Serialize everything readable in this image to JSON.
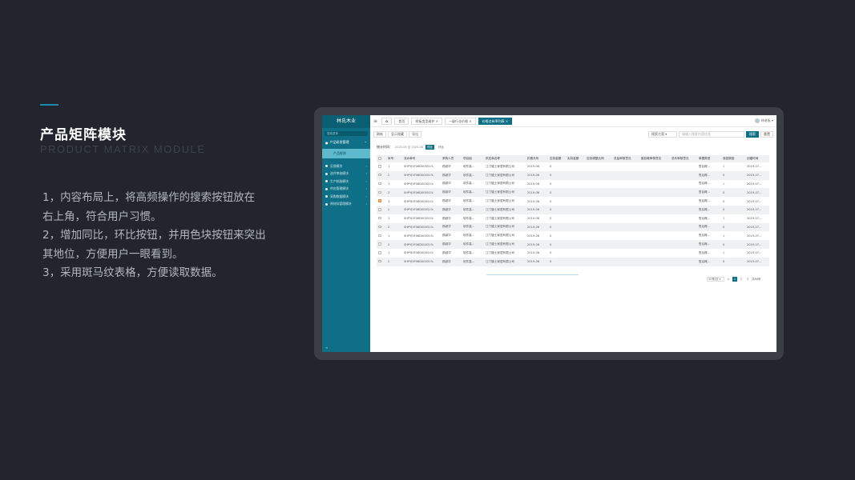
{
  "slide": {
    "title": "产品矩阵模块",
    "subtitle": "PRODUCT MATRIX MODULE",
    "points": [
      "1，内容布局上，将高频操作的搜索按钮放在",
      "右上角，符合用户习惯。",
      "2，增加同比，环比按钮，并用色块按钮来突出",
      "其地位，方便用户一眼看到。",
      "3，采用斑马纹表格，方便读取数据。"
    ]
  },
  "app": {
    "logo": "林氏木业",
    "sidebar": {
      "search": "搜索菜单",
      "group": "产品研发管理",
      "active": "产品矩阵",
      "items": [
        "反馈模块",
        "选件审核模块",
        "生产制造模块",
        "供应管理模块",
        "采购数据模块",
        "原材料管理模块"
      ],
      "collapse": "≡"
    },
    "topbar": {
      "menu": "≡",
      "settings": "✿",
      "tabs": [
        {
          "label": "首页",
          "active": false
        },
        {
          "label": "样板类型维护 ×",
          "active": false
        },
        {
          "label": "一级行业价格 ×",
          "active": false
        },
        {
          "label": "价格点有率列表 ×",
          "active": true
        }
      ],
      "user": "林老板 ▾"
    },
    "toolbar": {
      "buttons": [
        "刷新",
        "显示隐藏",
        "导出"
      ],
      "scheme": "搜索方案  ▾",
      "search_placeholder": "请输入搜索内容信息",
      "search": "搜索",
      "reset": "重置"
    },
    "stat": {
      "label": "统计时间：",
      "range": "2020-06 至 2020-06",
      "yoy": "同比",
      "mom": "环比"
    },
    "table": {
      "headers": [
        "",
        "序号",
        "流水单号",
        "采购人员",
        "项目组",
        "供应商名称",
        "扣费月份",
        "应扣金额",
        "实扣金额",
        "应扣调整比例",
        "总监审核意见",
        "副总裁审核意见",
        "总价审核意见",
        "单据类型",
        "驳回原因",
        "创建时间"
      ],
      "rows": [
        [
          "",
          "1",
          "SHPYJ5F06D00051%",
          "颜颖华",
          "软件高...",
          "江门骏士家居有限公司",
          "2019-06",
          "0",
          "",
          "",
          "",
          "",
          "",
          "售后概...",
          "1",
          "2019-07..."
        ],
        [
          "",
          "2",
          "SHPYJ5F06D00051%",
          "颜颖华",
          "软件高...",
          "江门骏士家居有限公司",
          "2019-06",
          "0",
          "",
          "",
          "",
          "",
          "",
          "售后概...",
          "0",
          "2019-07..."
        ],
        [
          "",
          "1",
          "SHPYJ5F06D00051%",
          "颜颖华",
          "软件高...",
          "江门骏士家居有限公司",
          "2019-06",
          "0",
          "",
          "",
          "",
          "",
          "",
          "售后概...",
          "1",
          "2019-07..."
        ],
        [
          "",
          "2",
          "SHPYJ5F06D00051%",
          "颜颖华",
          "软件高...",
          "江门骏士家居有限公司",
          "2019-06",
          "0",
          "",
          "",
          "",
          "",
          "",
          "售后概...",
          "0",
          "2019-07..."
        ],
        [
          "flag",
          "3",
          "SHPYJ5F06D00051%",
          "颜颖华",
          "软件高...",
          "江门骏士家居有限公司",
          "2019-06",
          "0",
          "",
          "",
          "",
          "",
          "",
          "售后概...",
          "0",
          "2019-07..."
        ],
        [
          "",
          "2",
          "SHPYJ5F06D00051%",
          "颜颖华",
          "软件高...",
          "江门骏士家居有限公司",
          "2019-06",
          "0",
          "",
          "",
          "",
          "",
          "",
          "售后概...",
          "0",
          "2019-07..."
        ],
        [
          "",
          "1",
          "SHPYJ5F06D00051%",
          "颜颖华",
          "软件高...",
          "江门骏士家居有限公司",
          "2019-06",
          "0",
          "",
          "",
          "",
          "",
          "",
          "售后概...",
          "1",
          "2019-07..."
        ],
        [
          "",
          "2",
          "SHPYJ5F06D00051%",
          "颜颖华",
          "软件高...",
          "江门骏士家居有限公司",
          "2019-06",
          "0",
          "",
          "",
          "",
          "",
          "",
          "售后概...",
          "0",
          "2019-07..."
        ],
        [
          "",
          "1",
          "SHPYJ5F06D00051%",
          "颜颖华",
          "软件高...",
          "江门骏士家居有限公司",
          "2019-06",
          "0",
          "",
          "",
          "",
          "",
          "",
          "售后概...",
          "1",
          "2019-07..."
        ],
        [
          "",
          "2",
          "SHPYJ5F06D00051%",
          "颜颖华",
          "软件高...",
          "江门骏士家居有限公司",
          "2019-06",
          "0",
          "",
          "",
          "",
          "",
          "",
          "售后概...",
          "0",
          "2019-07..."
        ],
        [
          "",
          "1",
          "SHPYJ5F06D00051%",
          "颜颖华",
          "软件高...",
          "江门骏士家居有限公司",
          "2019-06",
          "0",
          "",
          "",
          "",
          "",
          "",
          "售后概...",
          "1",
          "2019-07..."
        ],
        [
          "",
          "2",
          "SHPYJ5F06D00051%",
          "颜颖华",
          "软件高...",
          "江门骏士家居有限公司",
          "2019-06",
          "0",
          "",
          "",
          "",
          "",
          "",
          "售后概...",
          "0",
          "2019-07..."
        ]
      ]
    },
    "pager": {
      "size": "50条/页 ▾",
      "prev": "<",
      "pages": [
        "1",
        "2",
        "3"
      ],
      "current": "1",
      "total": "共88条"
    }
  },
  "colors": {
    "background": "#22252e",
    "accent": "#1a8ca8",
    "brand": "#0e6f86",
    "alert": "#e0463c"
  }
}
